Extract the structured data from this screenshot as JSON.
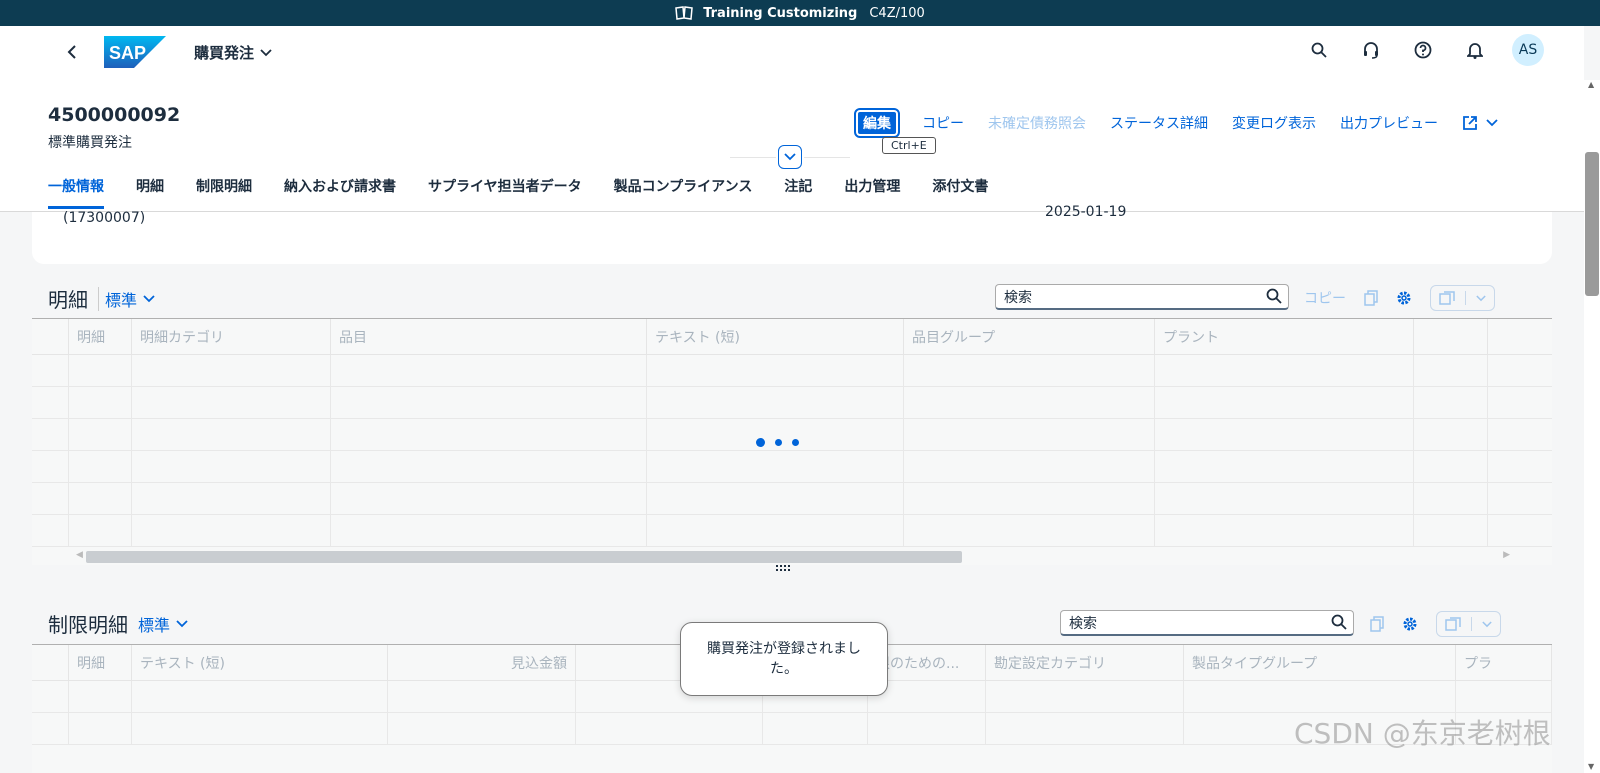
{
  "system_bar": {
    "title": "Training Customizing",
    "client": "C4Z/100"
  },
  "shell": {
    "app_title": "購買発注",
    "avatar_initials": "AS"
  },
  "header": {
    "document_number": "4500000092",
    "document_type": "標準購買発注",
    "actions": {
      "edit": "編集",
      "copy": "コピー",
      "open_liabilities": "未確定債務照会",
      "status_details": "ステータス詳細",
      "change_log": "変更ログ表示",
      "output_preview": "出力プレビュー"
    },
    "shortcut": "Ctrl+E"
  },
  "tabs": [
    "一般情報",
    "明細",
    "制限明細",
    "納入および請求書",
    "サプライヤ担当者データ",
    "製品コンプライアンス",
    "注記",
    "出力管理",
    "添付文書"
  ],
  "general_info": {
    "partial_value": "(17300007)",
    "partial_date": "2025-01-19"
  },
  "items_section": {
    "title": "明細",
    "variant": "標準",
    "search_placeholder": "検索",
    "copy_label": "コピー",
    "columns": [
      "明細",
      "明細カテゴリ",
      "品目",
      "テキスト (短)",
      "品目グループ",
      "プラント"
    ]
  },
  "limit_section": {
    "title": "制限明細",
    "variant": "標準",
    "search_placeholder": "検索",
    "columns": [
      "明細",
      "テキスト (短)",
      "見込金額",
      "",
      "限のための...",
      "勘定設定カテゴリ",
      "製品タイプグループ",
      "プラ"
    ]
  },
  "toast": "購買発注が登録されました。",
  "watermark": "CSDN @东京老树根"
}
